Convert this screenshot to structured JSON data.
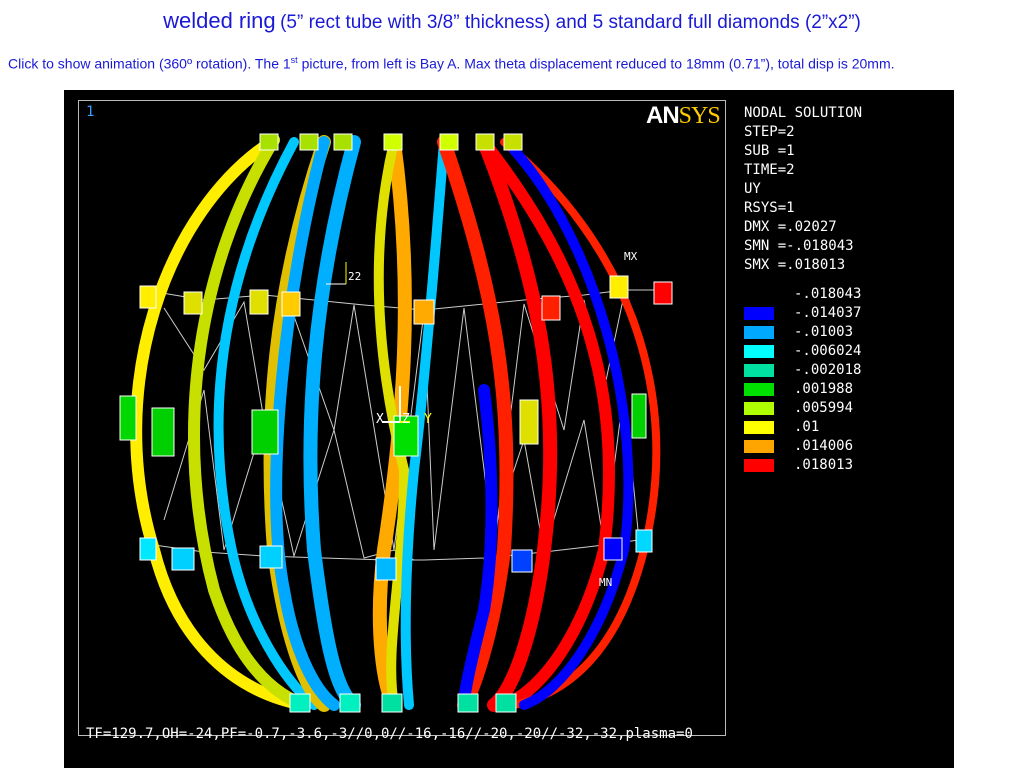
{
  "title": {
    "main": "welded ring",
    "sub": "(5” rect tube with 3/8” thickness) and 5 standard full diamonds (2”x2”)"
  },
  "caption": {
    "part1": "Click to show animation (360º rotation). The 1",
    "sup": "st",
    "part2": " picture, from left is Bay A. Max theta displacement reduced to 18mm (0.71”), total disp is 20mm."
  },
  "viewer": {
    "window_number": "1",
    "logo_an": "AN",
    "logo_sys": "SYS",
    "info_lines": [
      "NODAL SOLUTION",
      "STEP=2",
      "SUB =1",
      "TIME=2",
      "UY",
      "RSYS=1",
      "DMX =.02027",
      "SMN =-.018043",
      "SMX =.018013"
    ],
    "legend": [
      {
        "color": "#000000",
        "value": "-.018043"
      },
      {
        "color": "#0000ff",
        "value": "-.014037"
      },
      {
        "color": "#00a8ff",
        "value": "-.01003"
      },
      {
        "color": "#00ffff",
        "value": "-.006024"
      },
      {
        "color": "#00e0a0",
        "value": "-.002018"
      },
      {
        "color": "#00e000",
        "value": ".001988"
      },
      {
        "color": "#b0ff00",
        "value": ".005994"
      },
      {
        "color": "#ffff00",
        "value": ".01"
      },
      {
        "color": "#ffa500",
        "value": ".014006"
      },
      {
        "color": "#ff0000",
        "value": ".018013"
      }
    ],
    "labels": {
      "mx": "MX",
      "mn": "MN",
      "node": "22",
      "axis_x": "X",
      "axis_z": "Z",
      "axis_y": "Y"
    },
    "footer": "TF=129.7,OH=-24,PF=-0.7,-3.6,-3//0,0//-16,-16//-20,-20//-32,-32,plasma=0"
  }
}
